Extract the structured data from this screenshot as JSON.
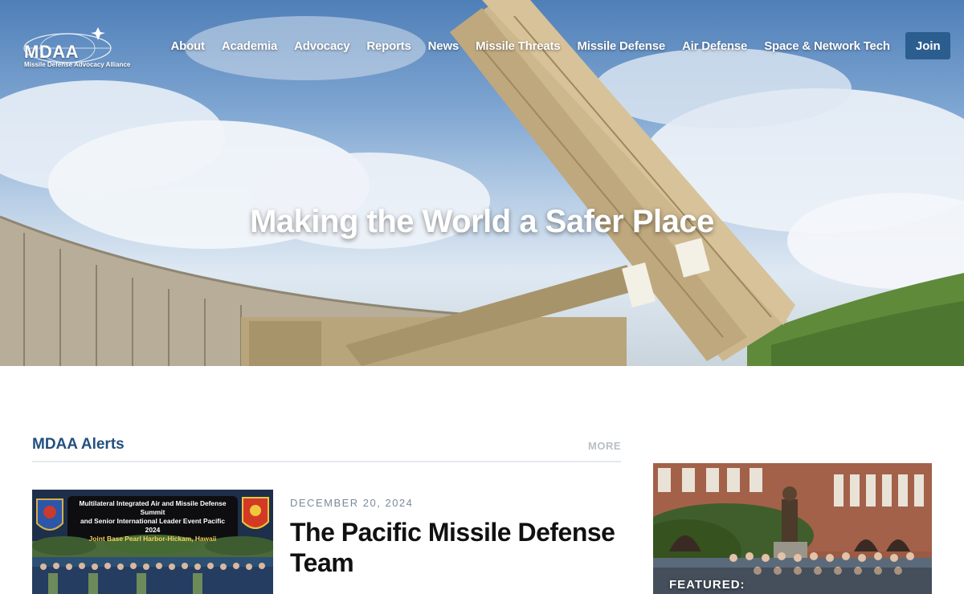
{
  "brand": {
    "logo_text": "MDAA",
    "logo_subtitle": "Missile Defense Advocacy Alliance"
  },
  "nav": {
    "items": [
      "About",
      "Academia",
      "Advocacy",
      "Reports",
      "News",
      "Missile Threats",
      "Missile Defense",
      "Air Defense",
      "Space & Network Tech"
    ],
    "join_label": "Join",
    "search_icon": "search-icon"
  },
  "hero": {
    "title": "Making the World a Safer Place"
  },
  "alerts": {
    "heading": "MDAA Alerts",
    "more_label": "MORE",
    "item": {
      "image_caption_line1": "Multilateral Integrated Air and Missile Defense Summit",
      "image_caption_line2": "and Senior International Leader Event Pacific",
      "image_caption_line3": "2024",
      "image_caption_line4": "Joint Base Pearl Harbor-Hickam, Hawaii",
      "date": "DECEMBER 20, 2024",
      "title": "The Pacific Missile Defense Team"
    }
  },
  "featured": {
    "label": "FEATURED:"
  },
  "colors": {
    "accent": "#2c5d8f",
    "heading": "#23507f",
    "muted": "#b9bec4"
  }
}
